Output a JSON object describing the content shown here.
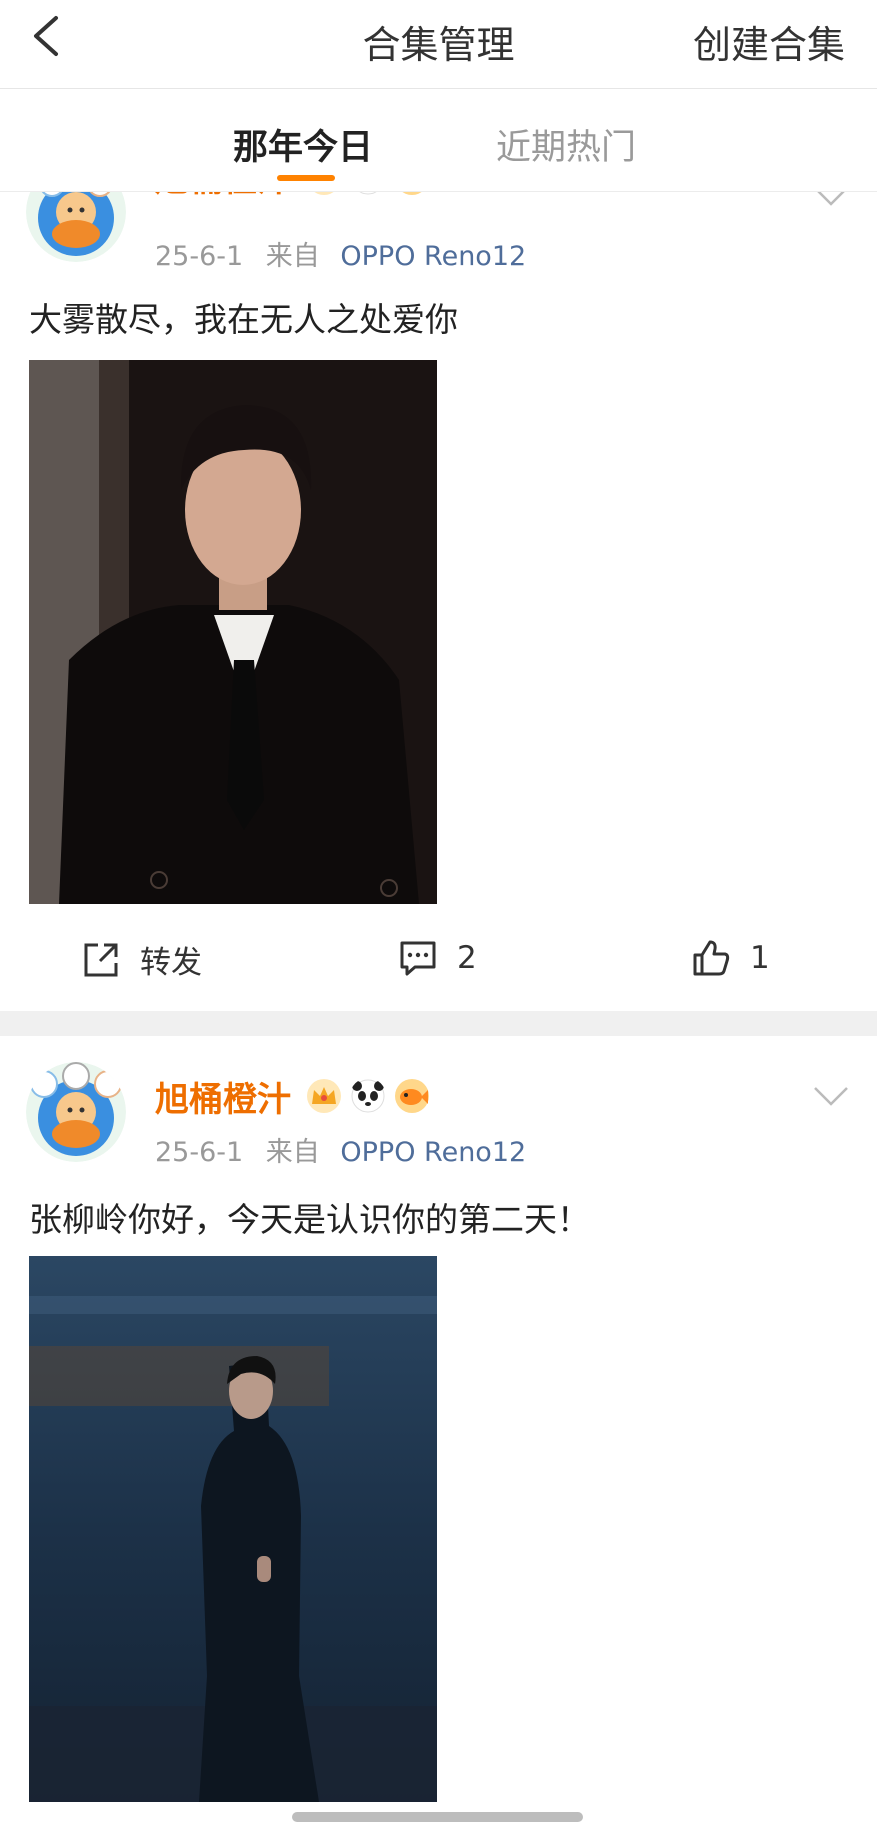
{
  "header": {
    "title": "合集管理",
    "create_label": "创建合集",
    "back_icon": "chevron-left-icon"
  },
  "tabs": [
    {
      "label": "那年今日",
      "active": true
    },
    {
      "label": "近期热门",
      "active": false
    }
  ],
  "accent_color": "#ff8200",
  "posts": [
    {
      "username": "旭桶橙汁",
      "badges": [
        "crown-badge-icon",
        "panda-badge-icon",
        "fish-badge-icon"
      ],
      "date": "25-6-1",
      "source_prefix": "来自",
      "device": "OPPO Reno12",
      "text": "大雾散尽，我在无人之处爱你",
      "actions": {
        "repost_label": "转发",
        "comments": "2",
        "likes": "1"
      }
    },
    {
      "username": "旭桶橙汁",
      "badges": [
        "crown-badge-icon",
        "panda-badge-icon",
        "fish-badge-icon"
      ],
      "date": "25-6-1",
      "source_prefix": "来自",
      "device": "OPPO Reno12",
      "text": "张柳岭你好，今天是认识你的第二天！"
    }
  ]
}
